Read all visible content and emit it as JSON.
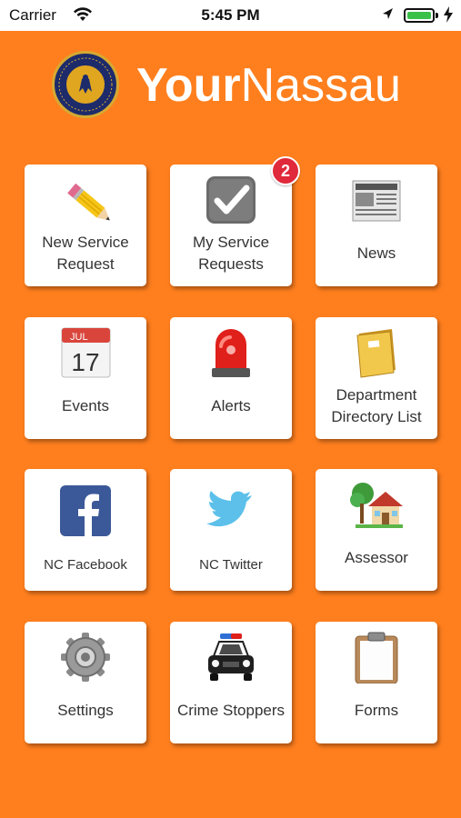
{
  "status_bar": {
    "carrier": "Carrier",
    "time": "5:45 PM"
  },
  "header": {
    "title_bold": "Your",
    "title_light": "Nassau"
  },
  "tiles": [
    {
      "label_line1": "New Service",
      "label_line2": "Request",
      "icon": "pencil-icon"
    },
    {
      "label_line1": "My Service",
      "label_line2": "Requests",
      "icon": "checkbox-icon",
      "badge": "2"
    },
    {
      "label": "News",
      "icon": "newspaper-icon"
    },
    {
      "label": "Events",
      "icon": "calendar-icon",
      "calendar_month": "JUL",
      "calendar_day": "17"
    },
    {
      "label": "Alerts",
      "icon": "siren-icon"
    },
    {
      "label_line1": "Department",
      "label_line2": "Directory List",
      "icon": "directory-book-icon"
    },
    {
      "label": "NC Facebook",
      "icon": "facebook-icon"
    },
    {
      "label": "NC Twitter",
      "icon": "twitter-icon"
    },
    {
      "label": "Assessor",
      "icon": "house-icon"
    },
    {
      "label": "Settings",
      "icon": "gear-icon"
    },
    {
      "label": "Crime Stoppers",
      "icon": "police-car-icon"
    },
    {
      "label": "Forms",
      "icon": "clipboard-icon"
    }
  ],
  "colors": {
    "background": "#ff7f1e",
    "tile": "#ffffff",
    "badge": "#e0293a",
    "battery": "#3ac14a"
  }
}
